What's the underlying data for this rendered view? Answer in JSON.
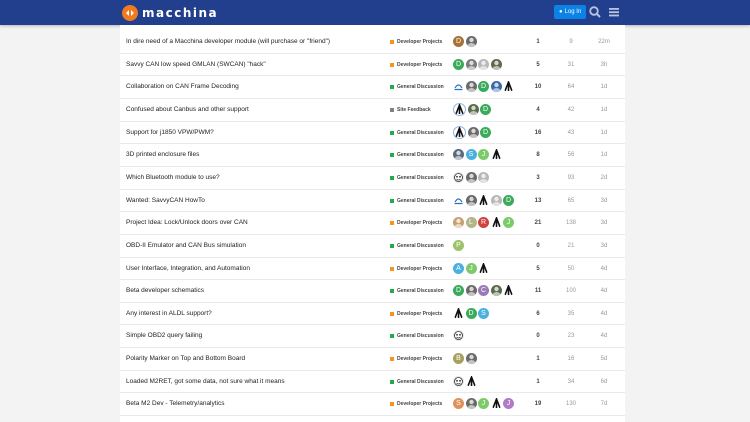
{
  "header": {
    "logo_text": "macchina",
    "login_label": "Log In",
    "login_icon": "user-icon",
    "search_icon": "search-icon",
    "menu_icon": "hamburger-menu-icon",
    "bg_color": "#213f8c",
    "accent_color": "#0a82e6"
  },
  "category_colors": {
    "Developer Projects": "#f7941d",
    "General Discussion": "#25aa4b",
    "Site Feedback": "#808281"
  },
  "topics": [
    {
      "title": "In dire need of a Macchina developer module (will purchase or \"friend\")",
      "category": "Developer Projects",
      "posters": [
        {
          "t": "D",
          "c": "#a87137"
        },
        {
          "t": "",
          "c": "#6a6a6a",
          "img": 1
        }
      ],
      "replies": "1",
      "views": "9",
      "activity": "22m"
    },
    {
      "title": "Savvy CAN low speed GMLAN (SWCAN) \"hack\"",
      "category": "Developer Projects",
      "posters": [
        {
          "t": "D",
          "c": "#3aaa5b"
        },
        {
          "t": "",
          "c": "#7a7a7a",
          "img": 1
        },
        {
          "t": "",
          "c": "#b8b8b8",
          "img": 1
        },
        {
          "t": "",
          "c": "#5a6a4a",
          "img": 1
        }
      ],
      "replies": "5",
      "views": "31",
      "activity": "3h"
    },
    {
      "title": "Collaboration on CAN Frame Decoding",
      "category": "General Discussion",
      "posters": [
        {
          "t": "",
          "c": "#ffffff",
          "img": 2
        },
        {
          "t": "",
          "c": "#6a6a6a",
          "img": 1
        },
        {
          "t": "D",
          "c": "#3aaa5b"
        },
        {
          "t": "",
          "c": "#3a6aa8",
          "img": 1
        },
        {
          "t": "",
          "c": "#ffffff",
          "img": 3
        }
      ],
      "replies": "10",
      "views": "64",
      "activity": "1d"
    },
    {
      "title": "Confused about Canbus and other support",
      "category": "Site Feedback",
      "posters": [
        {
          "t": "",
          "c": "#ffffff",
          "img": 3,
          "op": 1
        },
        {
          "t": "",
          "c": "#5a6a4a",
          "img": 1
        },
        {
          "t": "D",
          "c": "#3aaa5b"
        }
      ],
      "replies": "4",
      "views": "42",
      "activity": "1d"
    },
    {
      "title": "Support for j1850 VPW/PWM?",
      "category": "General Discussion",
      "posters": [
        {
          "t": "",
          "c": "#ffffff",
          "img": 3,
          "op": 1
        },
        {
          "t": "",
          "c": "#6a6a6a",
          "img": 1
        },
        {
          "t": "D",
          "c": "#3aaa5b"
        }
      ],
      "replies": "16",
      "views": "43",
      "activity": "1d"
    },
    {
      "title": "3D printed enclosure files",
      "category": "General Discussion",
      "posters": [
        {
          "t": "",
          "c": "#5a6a7a",
          "img": 1
        },
        {
          "t": "S",
          "c": "#4ab0e0"
        },
        {
          "t": "J",
          "c": "#7ccb6a"
        },
        {
          "t": "",
          "c": "#ffffff",
          "img": 3
        }
      ],
      "replies": "8",
      "views": "56",
      "activity": "1d"
    },
    {
      "title": "Which Bluetooth module to use?",
      "category": "General Discussion",
      "posters": [
        {
          "t": "",
          "c": "#e8e8e8",
          "img": 4
        },
        {
          "t": "",
          "c": "#6a6a6a",
          "img": 1
        },
        {
          "t": "",
          "c": "#b8b8b8",
          "img": 1
        }
      ],
      "replies": "3",
      "views": "93",
      "activity": "2d"
    },
    {
      "title": "Wanted: SavvyCAN HowTo",
      "category": "General Discussion",
      "posters": [
        {
          "t": "",
          "c": "#ffffff",
          "img": 2
        },
        {
          "t": "",
          "c": "#6a6a6a",
          "img": 1
        },
        {
          "t": "",
          "c": "#ffffff",
          "img": 3
        },
        {
          "t": "",
          "c": "#b8b8b8",
          "img": 1
        },
        {
          "t": "D",
          "c": "#3aaa5b"
        }
      ],
      "replies": "13",
      "views": "65",
      "activity": "3d"
    },
    {
      "title": "Project Idea: Lock/Unlock doors over CAN",
      "category": "Developer Projects",
      "posters": [
        {
          "t": "",
          "c": "#c8a070",
          "img": 1
        },
        {
          "t": "L",
          "c": "#b5b58a"
        },
        {
          "t": "R",
          "c": "#d2413c"
        },
        {
          "t": "",
          "c": "#ffffff",
          "img": 3
        },
        {
          "t": "J",
          "c": "#7ccb6a"
        }
      ],
      "replies": "21",
      "views": "138",
      "activity": "3d"
    },
    {
      "title": "OBD-II Emulator and CAN Bus simulation",
      "category": "General Discussion",
      "posters": [
        {
          "t": "P",
          "c": "#9cc26a"
        }
      ],
      "replies": "0",
      "views": "21",
      "activity": "3d"
    },
    {
      "title": "User Interface, Integration, and Automation",
      "category": "Developer Projects",
      "posters": [
        {
          "t": "A",
          "c": "#4ab0e0"
        },
        {
          "t": "J",
          "c": "#7ccb6a"
        },
        {
          "t": "",
          "c": "#ffffff",
          "img": 3
        }
      ],
      "replies": "5",
      "views": "50",
      "activity": "4d"
    },
    {
      "title": "Beta developer schematics",
      "category": "General Discussion",
      "posters": [
        {
          "t": "D",
          "c": "#3aaa5b"
        },
        {
          "t": "",
          "c": "#6a6a6a",
          "img": 1
        },
        {
          "t": "C",
          "c": "#9a7ab8"
        },
        {
          "t": "",
          "c": "#5a6a4a",
          "img": 1
        },
        {
          "t": "",
          "c": "#ffffff",
          "img": 3
        }
      ],
      "replies": "11",
      "views": "100",
      "activity": "4d"
    },
    {
      "title": "Any interest in ALDL support?",
      "category": "Developer Projects",
      "posters": [
        {
          "t": "",
          "c": "#ffffff",
          "img": 3
        },
        {
          "t": "D",
          "c": "#3aaa5b"
        },
        {
          "t": "S",
          "c": "#4ab0e0"
        }
      ],
      "replies": "6",
      "views": "35",
      "activity": "4d"
    },
    {
      "title": "Simple OBD2 query failing",
      "category": "General Discussion",
      "posters": [
        {
          "t": "",
          "c": "#e8e8e8",
          "img": 4
        }
      ],
      "replies": "0",
      "views": "23",
      "activity": "4d"
    },
    {
      "title": "Polarity Marker on Top and Bottom Board",
      "category": "Developer Projects",
      "posters": [
        {
          "t": "B",
          "c": "#a8a060"
        },
        {
          "t": "",
          "c": "#6a6a6a",
          "img": 1
        }
      ],
      "replies": "1",
      "views": "16",
      "activity": "5d"
    },
    {
      "title": "Loaded M2RET, got some data, not sure what it means",
      "category": "General Discussion",
      "posters": [
        {
          "t": "",
          "c": "#e8e8e8",
          "img": 4
        },
        {
          "t": "",
          "c": "#ffffff",
          "img": 3
        }
      ],
      "replies": "1",
      "views": "34",
      "activity": "6d"
    },
    {
      "title": "Beta M2 Dev - Telemetry/analytics",
      "category": "Developer Projects",
      "posters": [
        {
          "t": "S",
          "c": "#e0905a"
        },
        {
          "t": "",
          "c": "#6a6a6a",
          "img": 1
        },
        {
          "t": "J",
          "c": "#7ccb6a"
        },
        {
          "t": "",
          "c": "#ffffff",
          "img": 3
        },
        {
          "t": "J",
          "c": "#b07ac8"
        }
      ],
      "replies": "19",
      "views": "130",
      "activity": "7d"
    }
  ]
}
